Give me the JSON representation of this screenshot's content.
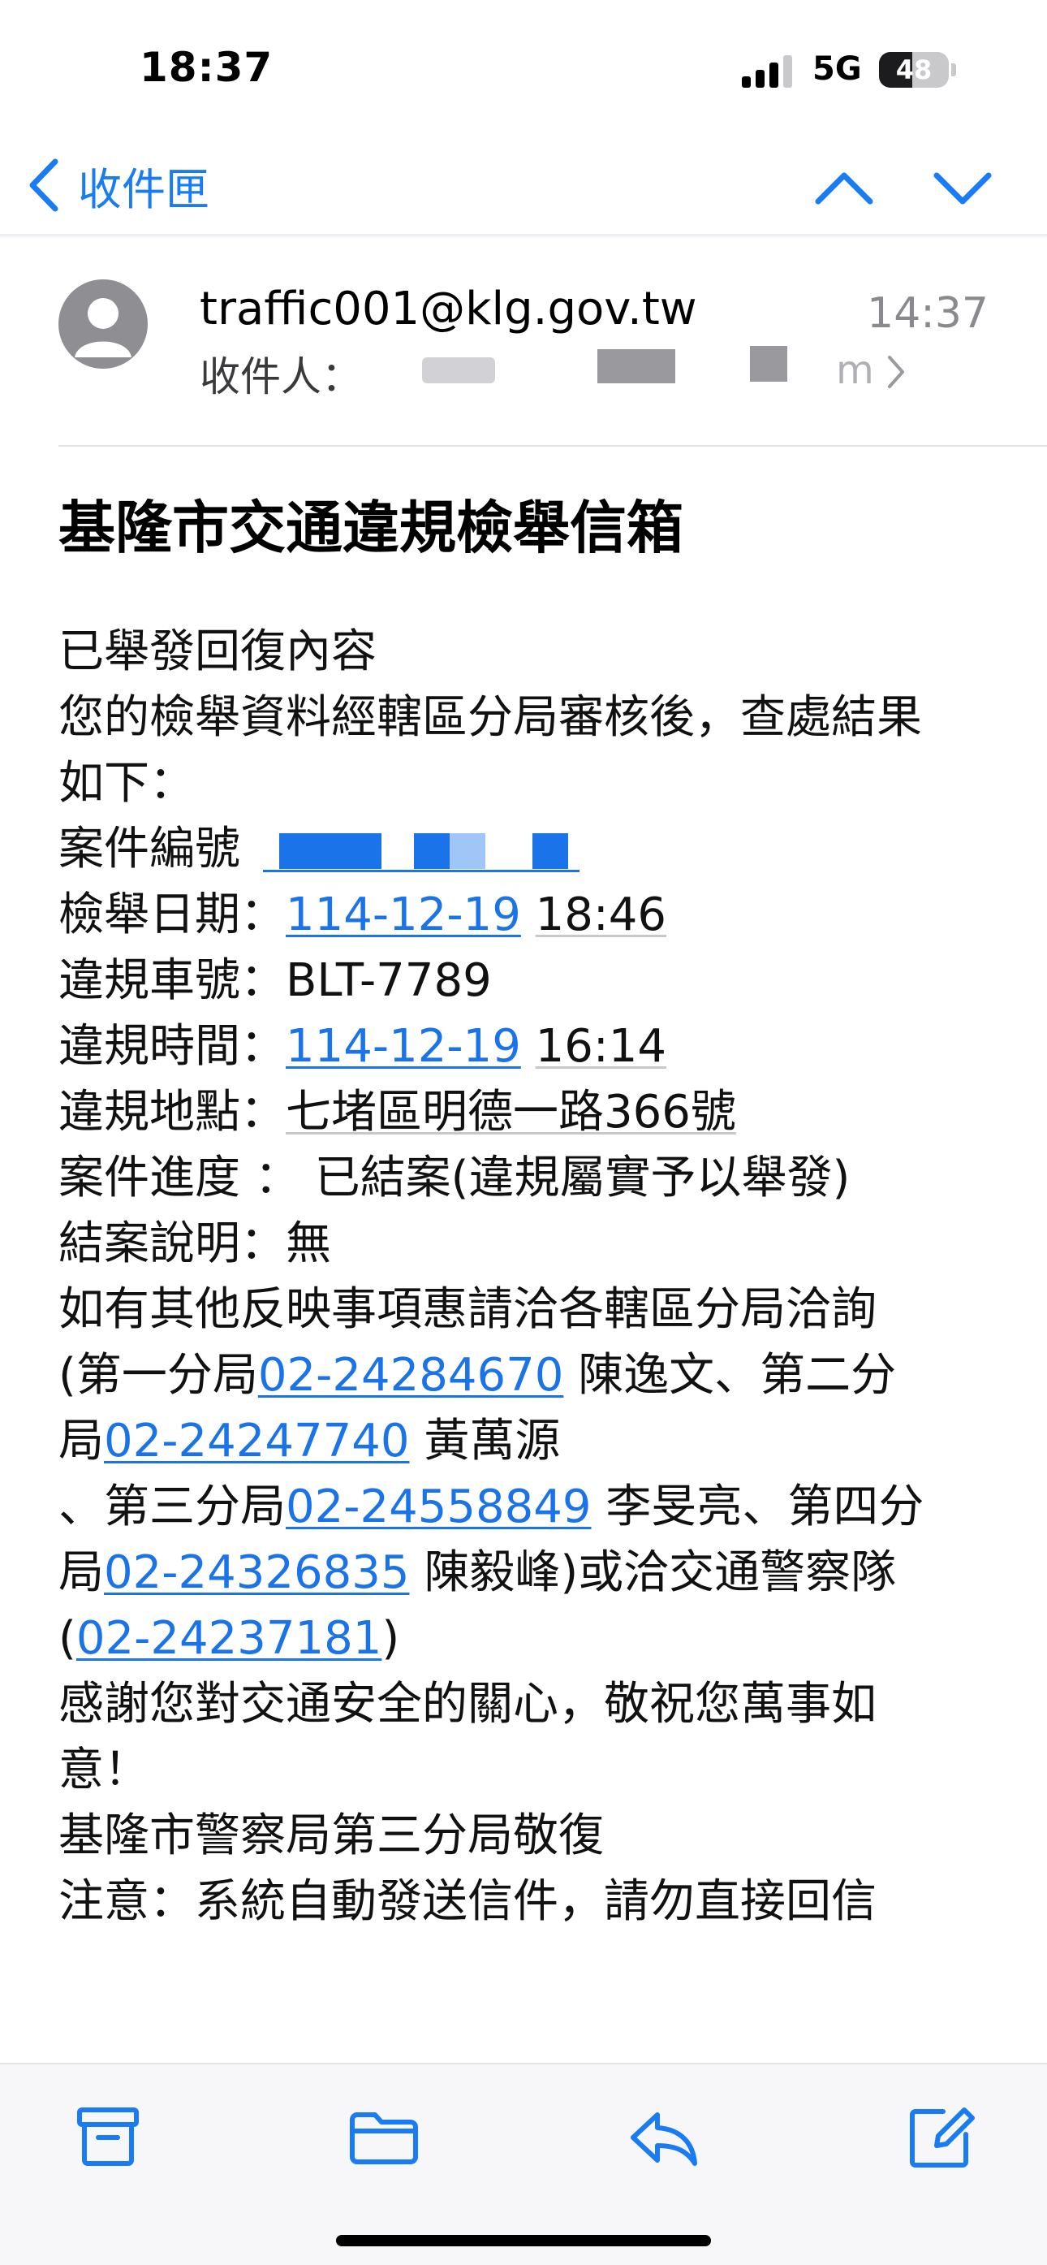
{
  "status": {
    "time": "18:37",
    "network": "5G",
    "battery": "48",
    "battery_level_percent": 48
  },
  "nav": {
    "back_label": "收件匣"
  },
  "message": {
    "sender": "traffic001@klg.gov.tw",
    "time": "14:37",
    "recipient_label": "收件人：",
    "recipient_tail": "m",
    "subject": "基隆市交通違規檢舉信箱"
  },
  "body": {
    "l1": "已舉發回復內容",
    "l2": "您的檢舉資料經轄區分局審核後，查處結果",
    "l3": "如下：",
    "case_no_label": "案件編號",
    "report_date_label": "檢舉日期：",
    "report_date": "114-12-19",
    "report_time": "18:46",
    "plate_label": "違規車號：",
    "plate": "BLT-7789",
    "viol_time_label": "違規時間：",
    "viol_date": "114-12-19",
    "viol_time": "16:14",
    "location_label": "違規地點：",
    "location": "七堵區明德一路366號",
    "progress_label": "案件進度 ：",
    "progress": "已結案(違規屬實予以舉發)",
    "note_label": "結案說明：",
    "note": "無",
    "contact_intro": "如有其他反映事項惠請洽各轄區分局洽詢",
    "c1_prefix": "(第一分局",
    "c1_phone": "02-24284670",
    "c1_name": "陳逸文、第二分",
    "c2_prefix": "局",
    "c2_phone": "02-24247740",
    "c2_name": "黃萬源",
    "c3_prefix": "、第三分局",
    "c3_phone": "02-24558849",
    "c3_name": "李旻亮、第四分",
    "c4_prefix": "局",
    "c4_phone": "02-24326835",
    "c4_name": "陳毅峰)或洽交通警察隊",
    "c5_open": "(",
    "c5_phone": "02-24237181",
    "c5_close": ")",
    "thanks1": "感謝您對交通安全的關心，敬祝您萬事如",
    "thanks2": "意！",
    "sign": "基隆市警察局第三分局敬復",
    "auto": "注意：系統自動發送信件，請勿直接回信"
  }
}
